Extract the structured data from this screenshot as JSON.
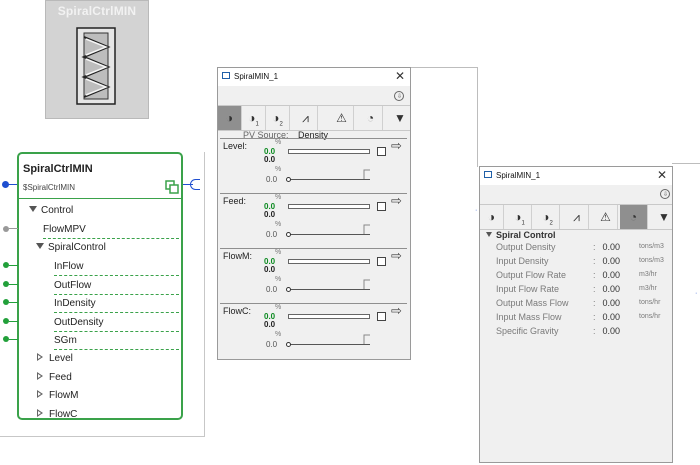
{
  "icon": {
    "title": "SpiralCtrlMIN"
  },
  "block": {
    "title": "SpiralCtrlMIN",
    "tag": "$SpiralCtrlMIN",
    "tree": [
      {
        "label": "Control",
        "indent": 0,
        "expanded": true
      },
      {
        "label": "FlowMPV",
        "indent": 1
      },
      {
        "label": "SpiralControl",
        "indent": 1,
        "expanded": true
      },
      {
        "label": "InFlow",
        "indent": 2
      },
      {
        "label": "OutFlow",
        "indent": 2
      },
      {
        "label": "InDensity",
        "indent": 2
      },
      {
        "label": "OutDensity",
        "indent": 2
      },
      {
        "label": "SGm",
        "indent": 2
      },
      {
        "label": "Level",
        "indent": 0,
        "expanded": false
      },
      {
        "label": "Feed",
        "indent": 0,
        "expanded": false
      },
      {
        "label": "FlowM",
        "indent": 0,
        "expanded": false
      },
      {
        "label": "FlowC",
        "indent": 0,
        "expanded": false
      }
    ]
  },
  "faceplate1": {
    "title": "SpiralMIN_1",
    "pv_source_label": "PV Source:",
    "pv_source_value": "Density",
    "sections": [
      {
        "name": "Level:",
        "pct1": "%",
        "v_green": "0.0",
        "v_black": "0.0",
        "pct2": "%",
        "v_gray": "0.0"
      },
      {
        "name": "Feed:",
        "pct1": "%",
        "v_green": "0.0",
        "v_black": "0.0",
        "pct2": "%",
        "v_gray": "0.0"
      },
      {
        "name": "FlowM:",
        "pct1": "%",
        "v_green": "0.0",
        "v_black": "0.0",
        "pct2": "%",
        "v_gray": "0.0"
      },
      {
        "name": "FlowC:",
        "pct1": "%",
        "v_green": "0.0",
        "v_black": "0.0",
        "pct2": "%",
        "v_gray": "0.0"
      }
    ],
    "toolbar_icons": [
      "home-icon",
      "loop-1-icon",
      "loop-2-icon",
      "trend-icon",
      "alarm-icon",
      "gauge-icon",
      "dropdown-icon"
    ]
  },
  "faceplate2": {
    "title": "SpiralMIN_1",
    "section_title": "Spiral Control",
    "rows": [
      {
        "label": "Output Density",
        "value": "0.00",
        "unit": "tons/m3"
      },
      {
        "label": "Input Density",
        "value": "0.00",
        "unit": "tons/m3"
      },
      {
        "label": "Output Flow Rate",
        "value": "0.00",
        "unit": "m3/hr"
      },
      {
        "label": "Input Flow Rate",
        "value": "0.00",
        "unit": "m3/hr"
      },
      {
        "label": "Output Mass Flow",
        "value": "0.00",
        "unit": "tons/hr"
      },
      {
        "label": "Input Mass Flow",
        "value": "0.00",
        "unit": "tons/hr"
      },
      {
        "label": "Specific Gravity",
        "value": "0.00",
        "unit": ""
      }
    ],
    "colon": ":"
  },
  "colors": {
    "accent_green": "#3aa24a",
    "value_green": "#0a8a1f",
    "pin_blue": "#1f4fd0"
  }
}
